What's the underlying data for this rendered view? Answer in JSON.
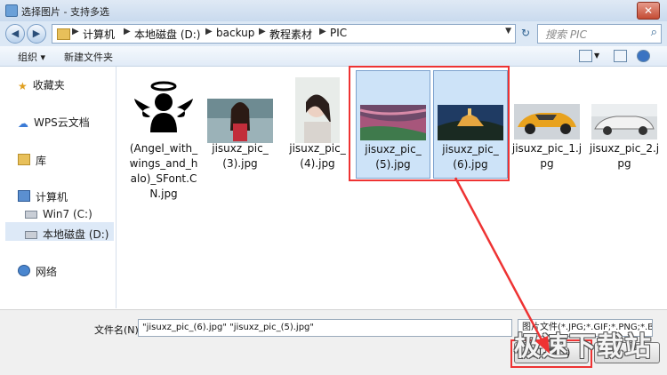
{
  "window": {
    "title": "选择图片 - 支持多选"
  },
  "address": {
    "crumbs": [
      "计算机",
      "本地磁盘 (D:)",
      "backup",
      "教程素材",
      "PIC"
    ],
    "search_placeholder": "搜索 PIC"
  },
  "toolbar": {
    "organize_label": "组织 ▾",
    "new_folder_label": "新建文件夹"
  },
  "sidebar": {
    "items": [
      {
        "label": "收藏夹",
        "icon": "star-icon"
      },
      {
        "label": "WPS云文档",
        "icon": "cloud-icon"
      },
      {
        "label": "库",
        "icon": "library-icon"
      },
      {
        "label": "计算机",
        "icon": "computer-icon"
      },
      {
        "label": "Win7 (C:)",
        "icon": "drive-icon"
      },
      {
        "label": "本地磁盘 (D:)",
        "icon": "drive-icon"
      },
      {
        "label": "网络",
        "icon": "network-icon"
      }
    ]
  },
  "files": [
    {
      "name": "(Angel_with_wings_and_halo)_SFont.CN.jpg",
      "selected": false
    },
    {
      "name": "jisuxz_pic_(3).jpg",
      "selected": false
    },
    {
      "name": "jisuxz_pic_(4).jpg",
      "selected": false
    },
    {
      "name": "jisuxz_pic_(5).jpg",
      "selected": true
    },
    {
      "name": "jisuxz_pic_(6).jpg",
      "selected": true
    },
    {
      "name": "jisuxz_pic_1.jpg",
      "selected": false
    },
    {
      "name": "jisuxz_pic_2.jpg",
      "selected": false
    }
  ],
  "bottom": {
    "filename_label": "文件名(N):",
    "filename_value": "\"jisuxz_pic_(6).jpg\" \"jisuxz_pic_(5).jpg\"",
    "filetype_value": "图片文件(*.JPG;*.GIF;*.PNG;*.B",
    "open_label": "打开(O)"
  },
  "watermark": "极速下载站",
  "colors": {
    "highlight": "#e33333",
    "selection": "#cde3f8"
  }
}
